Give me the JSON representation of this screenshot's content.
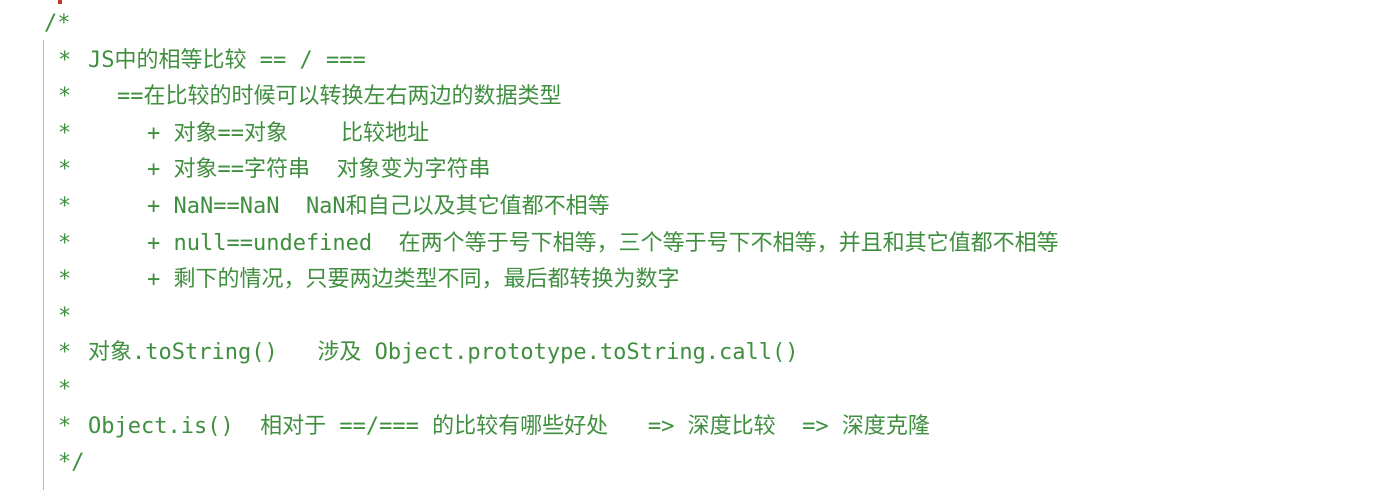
{
  "editor": {
    "accent_color": "#3f8f3f",
    "lines": [
      {
        "prefix": "/*",
        "text": ""
      },
      {
        "prefix": "*",
        "text": "JS中的相等比较 == / ==="
      },
      {
        "prefix": "*",
        "text": "==在比较的时候可以转换左右两边的数据类型"
      },
      {
        "prefix": "*",
        "text": "+ 对象==对象    比较地址"
      },
      {
        "prefix": "*",
        "text": "+ 对象==字符串  对象变为字符串"
      },
      {
        "prefix": "*",
        "text": "+ NaN==NaN  NaN和自己以及其它值都不相等"
      },
      {
        "prefix": "*",
        "text": "+ null==undefined  在两个等于号下相等，三个等于号下不相等，并且和其它值都不相等"
      },
      {
        "prefix": "*",
        "text": "+ 剩下的情况，只要两边类型不同，最后都转换为数字"
      },
      {
        "prefix": "*",
        "text": ""
      },
      {
        "prefix": "*",
        "text": "对象.toString()   涉及 Object.prototype.toString.call()"
      },
      {
        "prefix": "*",
        "text": ""
      },
      {
        "prefix": "*",
        "text": "Object.is()  相对于 ==/=== 的比较有哪些好处   => 深度比较  => 深度克隆"
      },
      {
        "prefix": "*/",
        "text": ""
      }
    ]
  }
}
